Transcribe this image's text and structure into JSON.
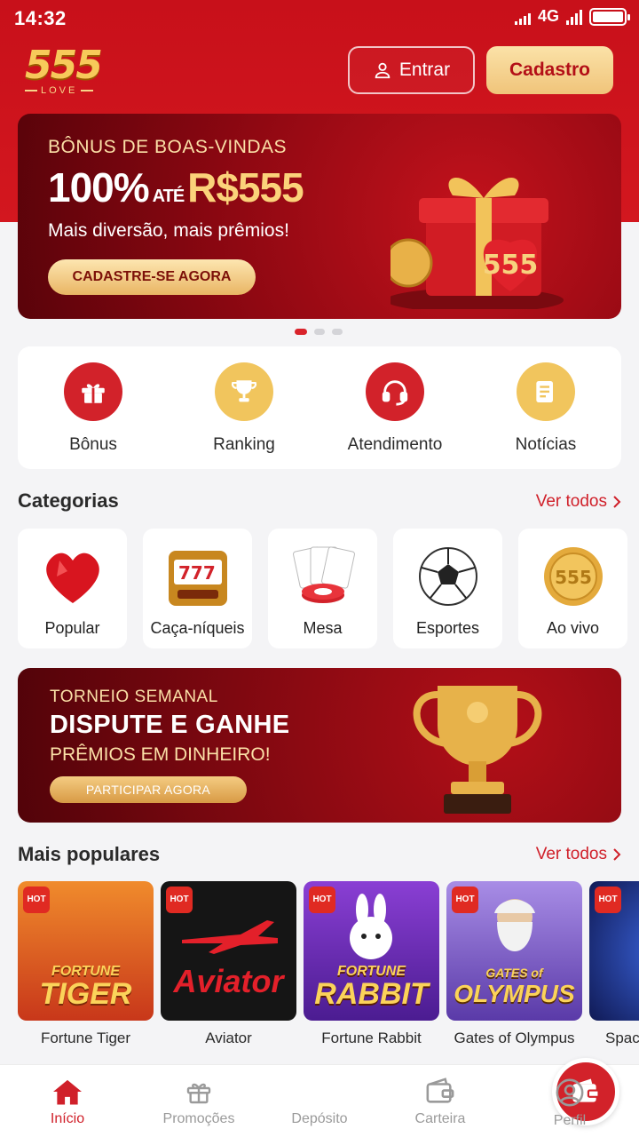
{
  "status_bar": {
    "time": "14:32",
    "network": "4G"
  },
  "header": {
    "logo_number": "555",
    "logo_sub": "LOVE",
    "login_label": "Entrar",
    "signup_label": "Cadastro"
  },
  "hero": {
    "eyebrow": "BÔNUS DE BOAS-VINDAS",
    "title_main": "100%",
    "title_small": "ATÉ",
    "title_amount": "R$555",
    "subtitle": "Mais diversão, mais prêmios!",
    "cta": "CADASTRE-SE AGORA",
    "badge": "555",
    "slides_total": 3,
    "slide_active": 1
  },
  "quick_actions": [
    {
      "label": "Bônus",
      "icon": "gift-icon",
      "style": "red"
    },
    {
      "label": "Ranking",
      "icon": "trophy-icon",
      "style": "gold"
    },
    {
      "label": "Atendimento",
      "icon": "headset-icon",
      "style": "red"
    },
    {
      "label": "Notícias",
      "icon": "news-icon",
      "style": "gold"
    }
  ],
  "categories": {
    "title": "Categorias",
    "see_all": "Ver todos",
    "items": [
      {
        "label": "Popular",
        "icon": "heart-icon"
      },
      {
        "label": "Caça-níqueis",
        "icon": "slot-machine-icon"
      },
      {
        "label": "Mesa",
        "icon": "cards-icon"
      },
      {
        "label": "Esportes",
        "icon": "soccer-ball-icon"
      },
      {
        "label": "Ao vivo",
        "icon": "coin-icon",
        "badge": "555"
      }
    ]
  },
  "tournament": {
    "eyebrow": "TORNEIO SEMANAL",
    "title": "DISPUTE E GANHE",
    "subtitle": "PRÊMIOS EM DINHEIRO!",
    "cta": "PARTICIPAR AGORA"
  },
  "popular": {
    "title": "Mais populares",
    "see_all": "Ver todos",
    "hot_label": "HOT",
    "games": [
      {
        "label": "Fortune Tiger",
        "art_line1": "FORTUNE",
        "art_line2": "TIGER",
        "color": "#e2551b"
      },
      {
        "label": "Aviator",
        "art_line1": "",
        "art_line2": "Aviator",
        "color": "#1a1a1a"
      },
      {
        "label": "Fortune Rabbit",
        "art_line1": "FORTUNE",
        "art_line2": "RABBIT",
        "color": "#6f2bbf"
      },
      {
        "label": "Gates of Olympus",
        "art_line1": "GATES of",
        "art_line2": "OLYMPUS",
        "color": "#7b5ac9"
      },
      {
        "label": "Space",
        "art_line1": "",
        "art_line2": "",
        "color": "#1f2a8a"
      }
    ]
  },
  "bottom_nav": {
    "items": [
      {
        "label": "Início",
        "icon": "home-icon",
        "active": true
      },
      {
        "label": "Promoções",
        "icon": "gift-icon",
        "active": false
      },
      {
        "label": "Depósito",
        "icon": "wallet-icon",
        "active": false
      },
      {
        "label": "Carteira",
        "icon": "wallet-outline-icon",
        "active": false
      },
      {
        "label": "Perfil",
        "icon": "user-icon",
        "active": false
      }
    ]
  },
  "colors": {
    "brand_red": "#d2222a",
    "gold": "#f1c55d",
    "text_dark": "#222222"
  }
}
